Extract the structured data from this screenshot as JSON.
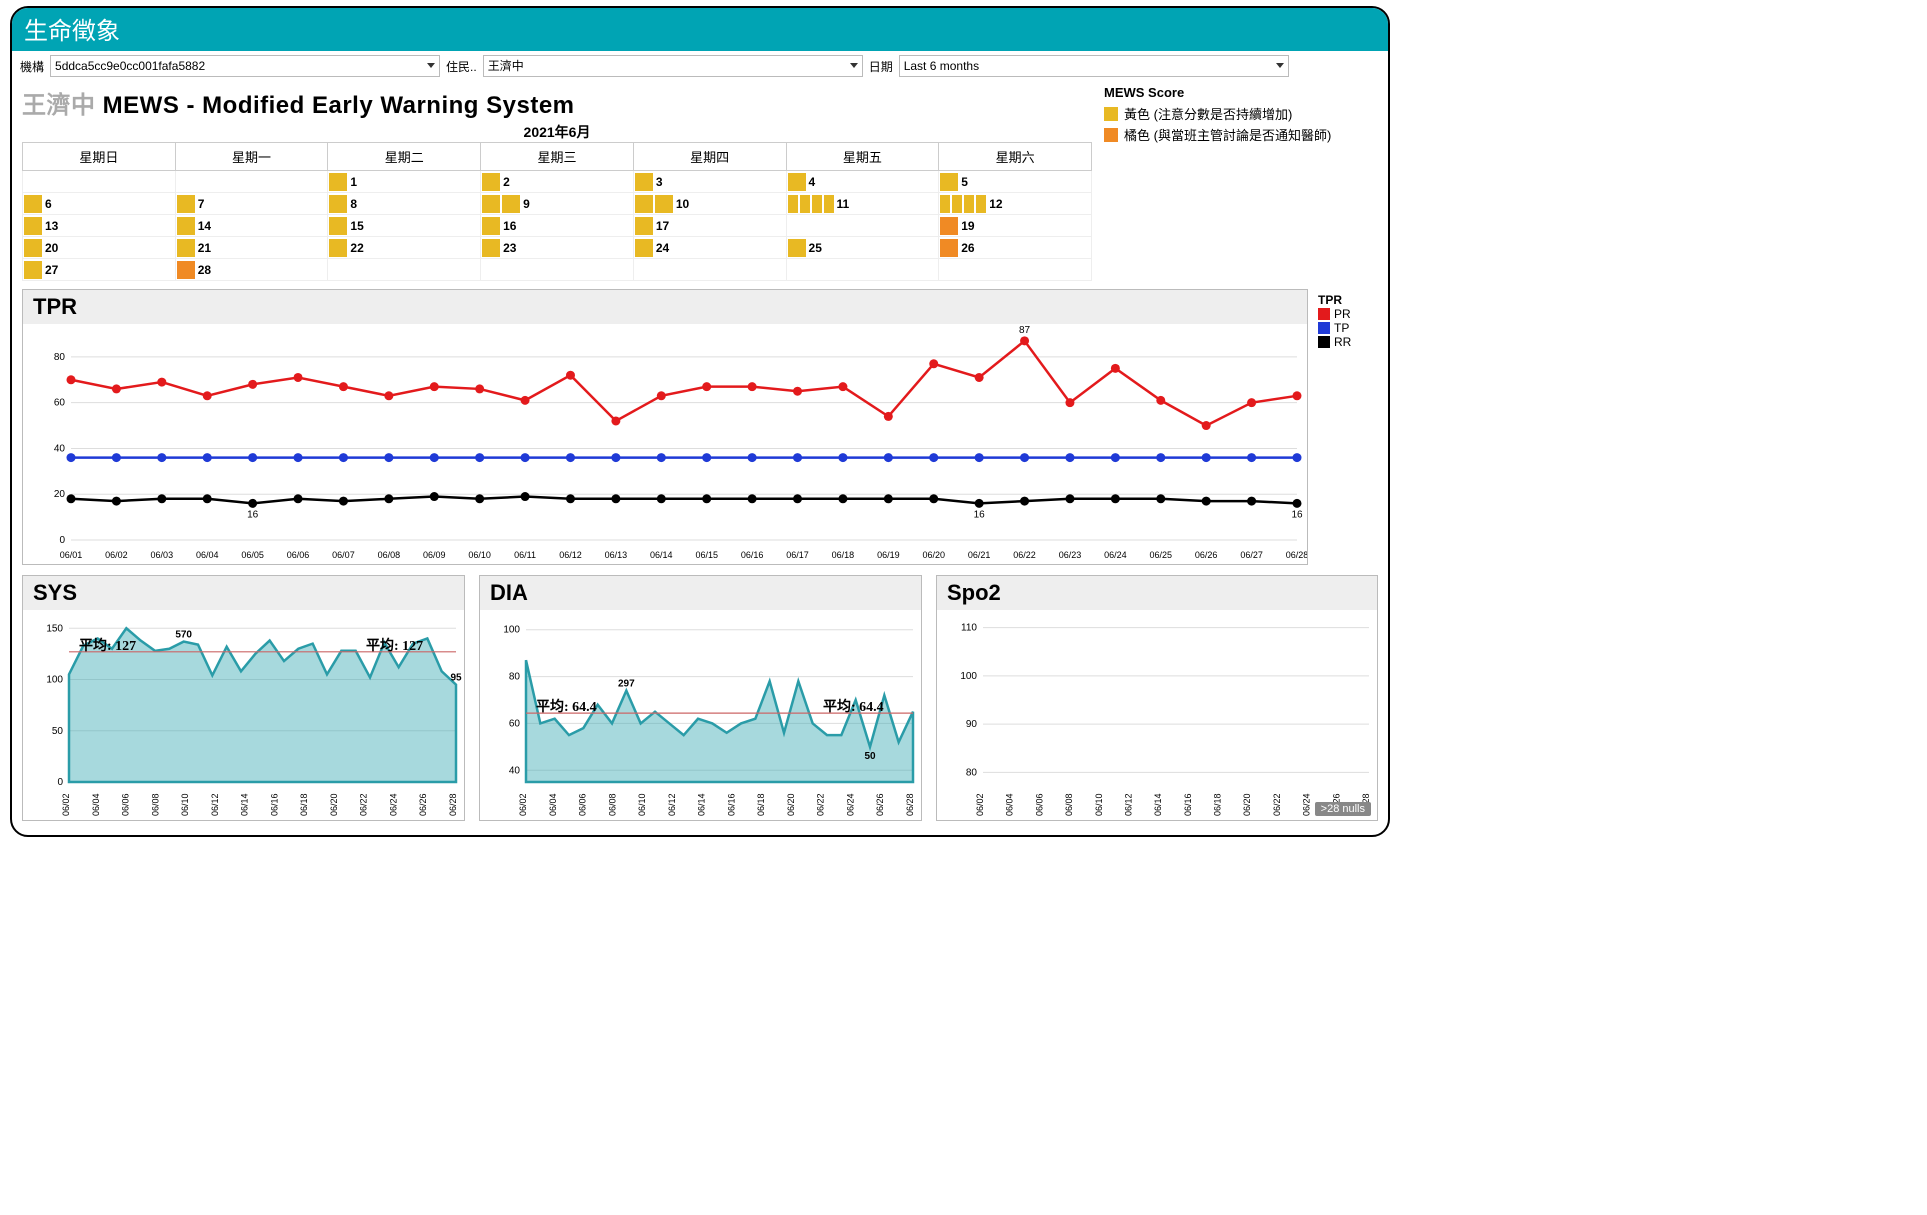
{
  "title": "生命徵象",
  "filters": {
    "org_label": "機構",
    "org_value": "5ddca5cc9e0cc001fafa5882",
    "resident_label": "住民..",
    "resident_value": "王濟中",
    "date_label": "日期",
    "date_value": "Last 6 months"
  },
  "mews": {
    "resident": "王濟中",
    "title": "MEWS - Modified Early Warning System",
    "month": "2021年6月",
    "weekdays": [
      "星期日",
      "星期一",
      "星期二",
      "星期三",
      "星期四",
      "星期五",
      "星期六"
    ],
    "legend_title": "MEWS Score",
    "legend_yellow": "黃色 (注意分數是否持續增加)",
    "legend_orange": "橘色 (與當班主管討論是否通知醫師)"
  },
  "tpr_legend": {
    "title": "TPR",
    "pr": "PR",
    "tp": "TP",
    "rr": "RR"
  },
  "labels": {
    "tpr": "TPR",
    "sys": "SYS",
    "dia": "DIA",
    "spo2": "Spo2",
    "nulls": ">28 nulls"
  },
  "chart_data": [
    {
      "type": "calendar-heat",
      "title": "MEWS calendar 2021-06",
      "weeks": [
        [
          null,
          null,
          {
            "d": 1,
            "y": 1
          },
          {
            "d": 2,
            "y": 1
          },
          {
            "d": 3,
            "y": 1
          },
          {
            "d": 4,
            "y": 1
          },
          {
            "d": 5,
            "y": 1
          }
        ],
        [
          {
            "d": 6,
            "y": 1
          },
          {
            "d": 7,
            "y": 1
          },
          {
            "d": 8,
            "y": 1
          },
          {
            "d": 9,
            "y": 2
          },
          {
            "d": 10,
            "y": 2
          },
          {
            "d": 11,
            "y": 4
          },
          {
            "d": 12,
            "y": 4
          }
        ],
        [
          {
            "d": 13,
            "y": 1
          },
          {
            "d": 14,
            "y": 1
          },
          {
            "d": 15,
            "y": 1
          },
          {
            "d": 16,
            "y": 1
          },
          {
            "d": 17,
            "y": 1
          },
          null,
          {
            "d": 19,
            "o": 1
          }
        ],
        [
          {
            "d": 20,
            "y": 1
          },
          {
            "d": 21,
            "y": 1
          },
          {
            "d": 22,
            "y": 1
          },
          {
            "d": 23,
            "y": 1
          },
          {
            "d": 24,
            "y": 1
          },
          {
            "d": 25,
            "y": 1
          },
          {
            "d": 26,
            "o": 1
          }
        ],
        [
          {
            "d": 27,
            "y": 1
          },
          {
            "d": 28,
            "o": 1
          },
          null,
          null,
          null,
          null,
          null
        ]
      ]
    },
    {
      "type": "line",
      "title": "TPR",
      "ylim": [
        0,
        90
      ],
      "yticks": [
        0,
        20,
        40,
        60,
        80
      ],
      "x": [
        "06/01",
        "06/02",
        "06/03",
        "06/04",
        "06/05",
        "06/06",
        "06/07",
        "06/08",
        "06/09",
        "06/10",
        "06/11",
        "06/12",
        "06/13",
        "06/14",
        "06/15",
        "06/16",
        "06/17",
        "06/18",
        "06/19",
        "06/20",
        "06/21",
        "06/22",
        "06/23",
        "06/24",
        "06/25",
        "06/26",
        "06/27",
        "06/28"
      ],
      "series": [
        {
          "name": "PR",
          "color": "#e31a1c",
          "values": [
            70,
            66,
            69,
            63,
            68,
            71,
            67,
            63,
            67,
            66,
            61,
            72,
            52,
            63,
            67,
            67,
            65,
            67,
            54,
            77,
            71,
            87,
            60,
            75,
            61,
            50,
            60,
            63
          ]
        },
        {
          "name": "TP",
          "color": "#1f3ad6",
          "values": [
            36,
            36,
            36,
            36,
            36,
            36,
            36,
            36,
            36,
            36,
            36,
            36,
            36,
            36,
            36,
            36,
            36,
            36,
            36,
            36,
            36,
            36,
            36,
            36,
            36,
            36,
            36,
            36
          ]
        },
        {
          "name": "RR",
          "color": "#000",
          "values": [
            18,
            17,
            18,
            18,
            16,
            18,
            17,
            18,
            19,
            18,
            19,
            18,
            18,
            18,
            18,
            18,
            18,
            18,
            18,
            18,
            16,
            17,
            18,
            18,
            18,
            17,
            17,
            16
          ]
        }
      ],
      "annotations": [
        {
          "series": "RR",
          "i": 4,
          "text": "16"
        },
        {
          "series": "RR",
          "i": 20,
          "text": "16"
        },
        {
          "series": "RR",
          "i": 27,
          "text": "16"
        },
        {
          "series": "PR",
          "i": 21,
          "text": "87"
        }
      ]
    },
    {
      "type": "area",
      "title": "SYS",
      "ylim": [
        0,
        160
      ],
      "yticks": [
        0,
        50,
        100,
        150
      ],
      "x": [
        "06/02",
        "06/04",
        "06/06",
        "06/08",
        "06/10",
        "06/12",
        "06/14",
        "06/16",
        "06/18",
        "06/20",
        "06/22",
        "06/24",
        "06/26",
        "06/28"
      ],
      "values": [
        105,
        133,
        140,
        130,
        150,
        138,
        128,
        130,
        137,
        134,
        104,
        132,
        108,
        125,
        138,
        118,
        130,
        135,
        105,
        128,
        128,
        102,
        136,
        112,
        135,
        140,
        108,
        95
      ],
      "avg": 127,
      "avg_label": "平均: 127",
      "annotations": [
        {
          "i": 8,
          "text": "570",
          "pos": "above"
        },
        {
          "i": 27,
          "text": "95",
          "pos": "right"
        }
      ]
    },
    {
      "type": "area",
      "title": "DIA",
      "ylim": [
        35,
        105
      ],
      "yticks": [
        40,
        60,
        80,
        100
      ],
      "x": [
        "06/02",
        "06/04",
        "06/06",
        "06/08",
        "06/10",
        "06/12",
        "06/14",
        "06/16",
        "06/18",
        "06/20",
        "06/22",
        "06/24",
        "06/26",
        "06/28"
      ],
      "values": [
        87,
        60,
        62,
        55,
        58,
        68,
        60,
        74,
        60,
        65,
        60,
        55,
        62,
        60,
        56,
        60,
        62,
        78,
        56,
        78,
        60,
        55,
        55,
        70,
        50,
        72,
        52,
        65
      ],
      "avg": 64.4,
      "avg_label": "平均: 64.4",
      "annotations": [
        {
          "i": 7,
          "text": "297",
          "pos": "above"
        },
        {
          "i": 24,
          "text": "50",
          "pos": "below"
        }
      ]
    },
    {
      "type": "line",
      "title": "Spo2",
      "ylim": [
        78,
        112
      ],
      "yticks": [
        80,
        90,
        100,
        110
      ],
      "x": [
        "06/02",
        "06/04",
        "06/06",
        "06/08",
        "06/10",
        "06/12",
        "06/14",
        "06/16",
        "06/18",
        "06/20",
        "06/22",
        "06/24",
        "06/26",
        "06/28"
      ],
      "values": null,
      "nulls": ">28 nulls"
    }
  ]
}
